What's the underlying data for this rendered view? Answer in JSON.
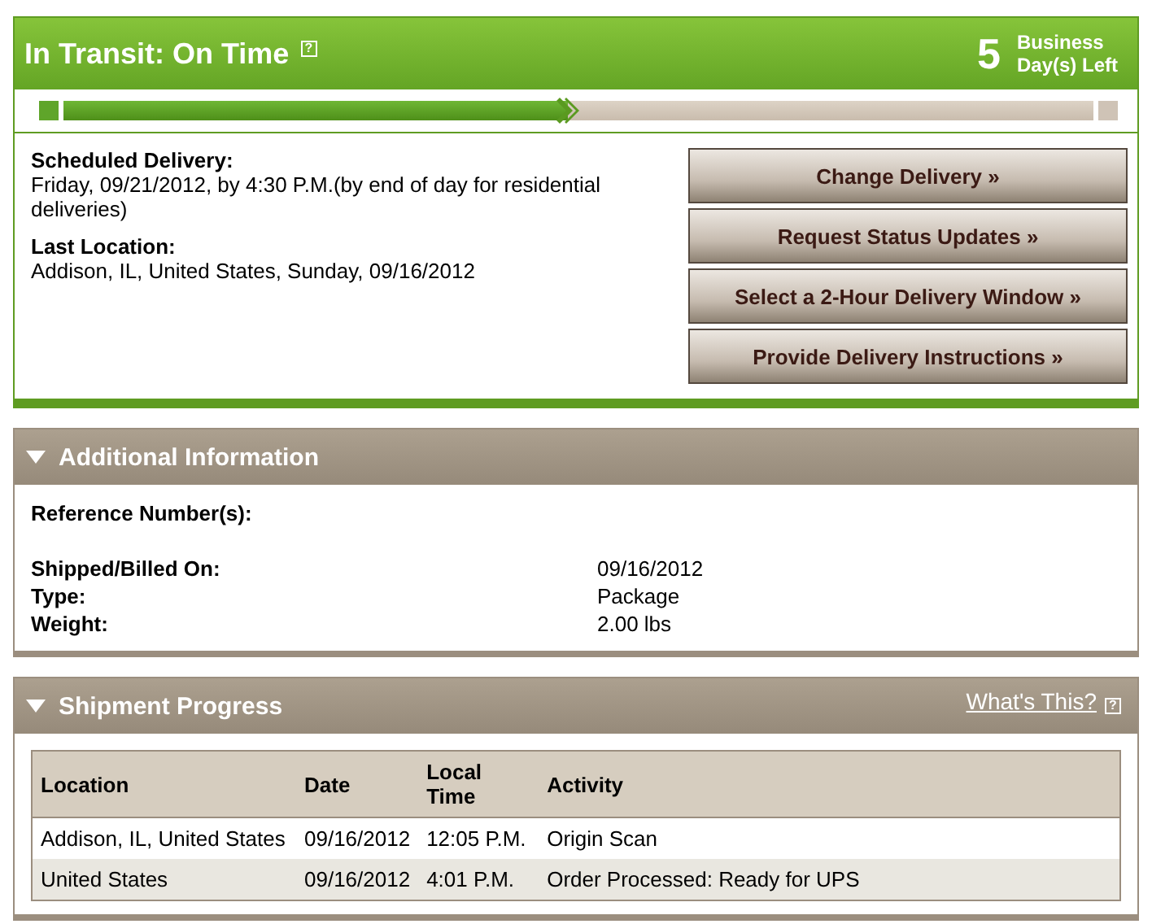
{
  "status": {
    "title": "In Transit: On Time",
    "help": "?",
    "days_count": "5",
    "days_label": "Business Day(s) Left",
    "progress": {
      "level": 0.49
    }
  },
  "delivery": {
    "fields": [
      {
        "label": "Scheduled Delivery:",
        "value": "Friday, 09/21/2012, by 4:30 P.M.(by end of day for residential deliveries)"
      },
      {
        "label": "Last Location:",
        "value": "Addison, IL, United States, Sunday, 09/16/2012"
      }
    ],
    "buttons": [
      "Change Delivery »",
      "Request Status Updates »",
      "Select a 2-Hour Delivery Window »",
      "Provide Delivery Instructions »"
    ]
  },
  "additional_information": {
    "title": "Additional Information",
    "expanded": true,
    "reference_label": "Reference Number(s):",
    "rows": [
      {
        "label": "Shipped/Billed On:",
        "value": "09/16/2012"
      },
      {
        "label": "Type:",
        "value": "Package"
      },
      {
        "label": "Weight:",
        "value": "2.00 lbs"
      }
    ]
  },
  "shipment_progress": {
    "title": "Shipment Progress",
    "expanded": true,
    "link": "What's This?",
    "help": "?",
    "table": {
      "columns": [
        "Location",
        "Date",
        "Local Time",
        "Activity"
      ],
      "rows": [
        [
          "Addison, IL, United States",
          "09/16/2012",
          "12:05 P.M.",
          "Origin Scan"
        ],
        [
          "United States",
          "09/16/2012",
          "4:01 P.M.",
          "Order Processed: Ready for UPS"
        ]
      ]
    }
  }
}
